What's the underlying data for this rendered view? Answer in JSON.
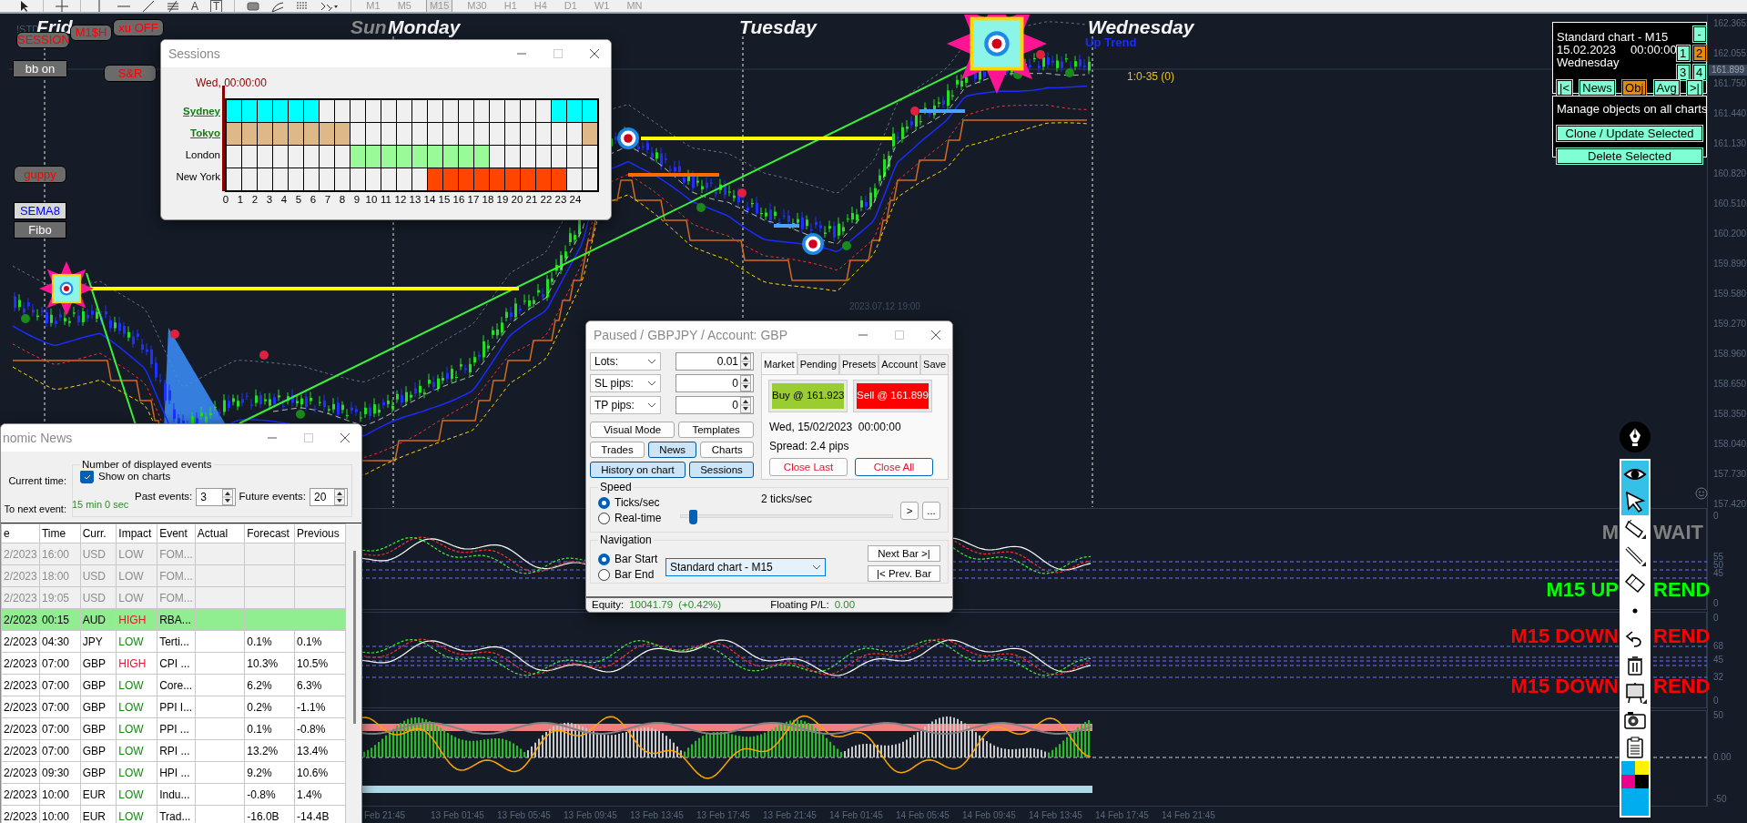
{
  "toolbar": {
    "tools": [
      {
        "kind": "cursor"
      },
      {
        "kind": "crosshair"
      },
      {
        "kind": "vline"
      },
      {
        "kind": "hline"
      },
      {
        "kind": "trendline"
      },
      {
        "kind": "fibo"
      },
      {
        "kind": "text",
        "label": "A"
      },
      {
        "kind": "textbox",
        "label": "T"
      },
      {
        "kind": "rect"
      },
      {
        "kind": "fibofan"
      },
      {
        "kind": "fibochannel"
      },
      {
        "kind": "more"
      }
    ],
    "timeframes": [
      {
        "label": "M1",
        "selected": false
      },
      {
        "label": "M5",
        "selected": false
      },
      {
        "label": "M15",
        "selected": true
      },
      {
        "label": "M30",
        "selected": false
      },
      {
        "label": "H1",
        "selected": false
      },
      {
        "label": "H4",
        "selected": false
      },
      {
        "label": "D1",
        "selected": false
      },
      {
        "label": "W1",
        "selected": false
      },
      {
        "label": "MN",
        "selected": false
      }
    ]
  },
  "chart": {
    "symbol_label": "!STD",
    "day_labels": [
      {
        "text": "Frid",
        "muted": false
      },
      {
        "text": "Sun",
        "muted": true
      },
      {
        "text": "Monday",
        "muted": false
      },
      {
        "text": "Tuesday",
        "muted": false
      },
      {
        "text": "Wednesday",
        "muted": false
      }
    ],
    "trend_label": "Up Trend",
    "trade_label": "1:0-35 (0)",
    "time_marker": "2023.07.12 19:00",
    "buttons": [
      {
        "label": "SESSION",
        "kind": "alert"
      },
      {
        "label": "M1$H",
        "kind": "alert"
      },
      {
        "label": "xu OFF",
        "kind": "alert"
      },
      {
        "label": "bb on",
        "kind": "plain"
      },
      {
        "label": "S&R",
        "kind": "alert"
      },
      {
        "label": "guppy",
        "kind": "alert"
      },
      {
        "label": "SEMA8",
        "kind": "accent"
      },
      {
        "label": "Fibo",
        "kind": "plain"
      }
    ],
    "signals": [
      {
        "left": "M",
        "right": "WAIT",
        "color": "#808080"
      },
      {
        "left": "M15 UP",
        "right": "REND",
        "color": "#00ff00"
      },
      {
        "left": "M15 DOWN",
        "right": "REND",
        "color": "#ff0000"
      },
      {
        "left": "M15 DOWN",
        "right": "REND",
        "color": "#ff0000"
      }
    ],
    "price_axis": [
      "162.365",
      "162.055",
      "161.750",
      "161.440",
      "161.130",
      "160.820",
      "160.510",
      "160.200",
      "159.890",
      "159.580",
      "159.270",
      "158.960",
      "158.650",
      "158.350",
      "158.040",
      "157.730",
      "157.420"
    ],
    "current_price": "161.899",
    "panes": [
      {
        "scale_labels": [
          "0",
          "55",
          "50",
          "45",
          "0"
        ]
      },
      {
        "scale_labels": [
          "0",
          "68",
          "45",
          "32",
          "0"
        ]
      },
      {
        "scale_labels": [
          "50",
          "0.00",
          "-50"
        ]
      }
    ],
    "time_axis": [
      "Feb 21:45",
      "13 Feb 01:45",
      "13 Feb 05:45",
      "13 Feb 09:45",
      "13 Feb 13:45",
      "13 Feb 17:45",
      "13 Feb 21:45",
      "14 Feb 01:45",
      "14 Feb 05:45",
      "14 Feb 09:45",
      "14 Feb 13:45",
      "14 Feb 17:45",
      "14 Feb 21:45"
    ]
  },
  "info_panel": {
    "chart": "Standard chart - M15",
    "date": "15.02.2023",
    "time": "00:00:00",
    "day": "Wednesday",
    "minimize": "-",
    "charts": [
      {
        "label": "1",
        "selected": false
      },
      {
        "label": "2",
        "selected": true
      },
      {
        "label": "3",
        "selected": false
      },
      {
        "label": "4",
        "selected": false
      }
    ],
    "nav": [
      {
        "label": "|<",
        "selected": false
      },
      {
        "label": "News",
        "selected": false
      },
      {
        "label": "Obj",
        "selected": true
      },
      {
        "label": "Avg",
        "selected": false
      },
      {
        "label": ">|",
        "selected": false
      }
    ],
    "manage_title": "Manage objects on all charts",
    "actions": [
      "Clone / Update Selected",
      "Delete Selected"
    ]
  },
  "sessions_window": {
    "title": "Sessions",
    "time": "Wed, 00:00:00",
    "sessions": [
      {
        "name": "Sydney",
        "highlighted": true,
        "color": "#00ffff",
        "active": [
          true,
          true,
          true,
          true,
          true,
          true,
          false,
          false,
          false,
          false,
          false,
          false,
          false,
          false,
          false,
          false,
          false,
          false,
          false,
          false,
          false,
          true,
          true,
          true
        ]
      },
      {
        "name": "Tokyo",
        "highlighted": true,
        "color": "#deb887",
        "active": [
          true,
          true,
          true,
          true,
          true,
          true,
          true,
          true,
          false,
          false,
          false,
          false,
          false,
          false,
          false,
          false,
          false,
          false,
          false,
          false,
          false,
          false,
          false,
          true
        ]
      },
      {
        "name": "London",
        "highlighted": false,
        "color": "#98fb98",
        "active": [
          false,
          false,
          false,
          false,
          false,
          false,
          false,
          false,
          true,
          true,
          true,
          true,
          true,
          true,
          true,
          true,
          true,
          false,
          false,
          false,
          false,
          false,
          false,
          false
        ]
      },
      {
        "name": "New York",
        "highlighted": false,
        "color": "#ff4500",
        "active": [
          false,
          false,
          false,
          false,
          false,
          false,
          false,
          false,
          false,
          false,
          false,
          false,
          false,
          true,
          true,
          true,
          true,
          true,
          true,
          true,
          true,
          true,
          false,
          false
        ]
      }
    ],
    "hours": [
      "0",
      "1",
      "2",
      "3",
      "4",
      "5",
      "6",
      "7",
      "8",
      "9",
      "10",
      "11",
      "12",
      "13",
      "14",
      "15",
      "16",
      "17",
      "18",
      "19",
      "20",
      "21",
      "22",
      "23",
      "24"
    ]
  },
  "trade_window": {
    "title": "Paused / GBPJPY / Account: GBP",
    "fields": [
      {
        "label": "Lots:",
        "value": "0.01"
      },
      {
        "label": "SL pips:",
        "value": "0"
      },
      {
        "label": "TP pips:",
        "value": "0"
      }
    ],
    "buttons": [
      {
        "label": "Visual Mode",
        "selected": false
      },
      {
        "label": "Templates",
        "selected": false
      },
      {
        "label": "Trades",
        "selected": false
      },
      {
        "label": "News",
        "selected": true
      },
      {
        "label": "Charts",
        "selected": false
      },
      {
        "label": "History on chart",
        "selected": true
      },
      {
        "label": "Sessions",
        "selected": true
      }
    ],
    "tabs": [
      {
        "label": "Market",
        "selected": true
      },
      {
        "label": "Pending",
        "selected": false
      },
      {
        "label": "Presets",
        "selected": false
      },
      {
        "label": "Account",
        "selected": false
      },
      {
        "label": "Save",
        "selected": false
      }
    ],
    "buy": "Buy @ 161.923",
    "sell": "Sell @ 161.899",
    "datetime": "Wed, 15/02/2023  00:00:00",
    "spread": "Spread: 2.4 pips",
    "close_last": "Close Last",
    "close_all": "Close All",
    "speed": {
      "title": "Speed",
      "reading": "2 ticks/sec",
      "modes": [
        {
          "label": "Ticks/sec",
          "selected": true
        },
        {
          "label": "Real-time",
          "selected": false
        }
      ],
      "level": 0.04,
      "buttons": [
        ">",
        "..."
      ]
    },
    "navigation": {
      "title": "Navigation",
      "modes": [
        {
          "label": "Bar Start",
          "selected": true
        },
        {
          "label": "Bar End",
          "selected": false
        }
      ],
      "chart": "Standard chart - M15",
      "buttons": [
        "Next Bar >|",
        "|< Prev. Bar"
      ]
    },
    "status": {
      "equity_label": "Equity:",
      "equity": "10041.79",
      "change": "(+0.42%)",
      "pl_label": "Floating P/L:",
      "pl": "0.00"
    }
  },
  "news_window": {
    "title": "nomic News",
    "current_time_label": "Current time:",
    "next_event_label": "To next event:",
    "next_event": "15 min 0 sec",
    "group_title": "Number of displayed events",
    "show_on_charts": {
      "label": "Show on charts",
      "checked": true
    },
    "past_events": {
      "label": "Past events:",
      "value": "3"
    },
    "future_events": {
      "label": "Future events:",
      "value": "20"
    },
    "columns": [
      "e",
      "Time",
      "Curr.",
      "Impact",
      "Event",
      "Actual",
      "Forecast",
      "Previous"
    ],
    "rows": [
      {
        "kind": "past",
        "date": "2/2023",
        "time": "16:00",
        "currency": "USD",
        "impact": "LOW",
        "high": false,
        "event": "FOM..."
      },
      {
        "kind": "past",
        "date": "2/2023",
        "time": "18:00",
        "currency": "USD",
        "impact": "LOW",
        "high": false,
        "event": "FOM..."
      },
      {
        "kind": "past",
        "date": "2/2023",
        "time": "19:05",
        "currency": "USD",
        "impact": "LOW",
        "high": false,
        "event": "FOM..."
      },
      {
        "kind": "current",
        "date": "2/2023",
        "time": "00:15",
        "currency": "AUD",
        "impact": "HIGH",
        "high": true,
        "event": "RBA..."
      },
      {
        "kind": "future",
        "date": "2/2023",
        "time": "04:30",
        "currency": "JPY",
        "impact": "LOW",
        "high": false,
        "event": "Terti...",
        "forecast": "0.1%",
        "previous": "0.1%"
      },
      {
        "kind": "future",
        "date": "2/2023",
        "time": "07:00",
        "currency": "GBP",
        "impact": "HIGH",
        "high": true,
        "event": "CPI ...",
        "forecast": "10.3%",
        "previous": "10.5%"
      },
      {
        "kind": "future",
        "date": "2/2023",
        "time": "07:00",
        "currency": "GBP",
        "impact": "LOW",
        "high": false,
        "event": "Core...",
        "forecast": "6.2%",
        "previous": "6.3%"
      },
      {
        "kind": "future",
        "date": "2/2023",
        "time": "07:00",
        "currency": "GBP",
        "impact": "LOW",
        "high": false,
        "event": "PPI I...",
        "forecast": "0.2%",
        "previous": "-1.1%"
      },
      {
        "kind": "future",
        "date": "2/2023",
        "time": "07:00",
        "currency": "GBP",
        "impact": "LOW",
        "high": false,
        "event": "PPI ...",
        "forecast": "0.1%",
        "previous": "-0.8%"
      },
      {
        "kind": "future",
        "date": "2/2023",
        "time": "07:00",
        "currency": "GBP",
        "impact": "LOW",
        "high": false,
        "event": "RPI ...",
        "forecast": "13.2%",
        "previous": "13.4%"
      },
      {
        "kind": "future",
        "date": "2/2023",
        "time": "09:30",
        "currency": "GBP",
        "impact": "LOW",
        "high": false,
        "event": "HPI ...",
        "forecast": "9.2%",
        "previous": "10.6%"
      },
      {
        "kind": "future",
        "date": "2/2023",
        "time": "10:00",
        "currency": "EUR",
        "impact": "LOW",
        "high": false,
        "event": "Indu...",
        "forecast": "-0.8%",
        "previous": "1.4%"
      },
      {
        "kind": "future",
        "date": "2/2023",
        "time": "10:00",
        "currency": "EUR",
        "impact": "LOW",
        "high": false,
        "event": "Trad...",
        "forecast": "-16.0B",
        "previous": "-14.4B"
      }
    ]
  },
  "drawing_toolbar": {
    "tools": [
      {
        "kind": "eye",
        "selected": true
      },
      {
        "kind": "pointer",
        "selected": true
      },
      {
        "kind": "highlighter",
        "selected": false
      },
      {
        "kind": "pen",
        "selected": false
      },
      {
        "kind": "eraser",
        "selected": false
      },
      {
        "kind": "dot",
        "selected": false
      },
      {
        "kind": "undo",
        "selected": false
      },
      {
        "kind": "trash",
        "selected": false
      },
      {
        "kind": "easel",
        "selected": false
      },
      {
        "kind": "camera",
        "selected": false
      },
      {
        "kind": "clipboard",
        "selected": false
      },
      {
        "kind": "palette",
        "selected": false
      }
    ]
  }
}
